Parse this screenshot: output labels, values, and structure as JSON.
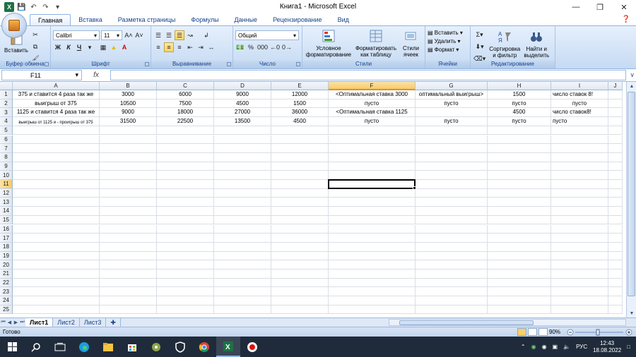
{
  "window": {
    "title": "Книга1 - Microsoft Excel"
  },
  "tabs": [
    "Главная",
    "Вставка",
    "Разметка страницы",
    "Формулы",
    "Данные",
    "Рецензирование",
    "Вид"
  ],
  "ribbon": {
    "clipboard": {
      "paste": "Вставить",
      "label": "Буфер обмена"
    },
    "font": {
      "name": "Calibri",
      "size": "11",
      "label": "Шрифт",
      "bold": "Ж",
      "italic": "К",
      "underline": "Ч"
    },
    "alignment": {
      "label": "Выравнивание"
    },
    "number": {
      "format": "Общий",
      "label": "Число",
      "percent": "%",
      "thousands": "000"
    },
    "styles": {
      "conditional": "Условное форматирование",
      "as_table": "Форматировать как таблицу",
      "cell_styles": "Стили ячеек",
      "label": "Стили"
    },
    "cells": {
      "insert": "Вставить",
      "delete": "Удалить",
      "format": "Формат",
      "label": "Ячейки"
    },
    "editing": {
      "sort": "Сортировка и фильтр",
      "find": "Найти и выделить",
      "label": "Редактирование"
    }
  },
  "formula_bar": {
    "name_box": "F11",
    "fx": "fx",
    "value": ""
  },
  "columns": [
    "A",
    "B",
    "C",
    "D",
    "E",
    "F",
    "G",
    "H",
    "I",
    "J"
  ],
  "rows": [
    "1",
    "2",
    "3",
    "4",
    "5",
    "6",
    "7",
    "8",
    "9",
    "10",
    "11",
    "12",
    "13",
    "14",
    "15",
    "16",
    "17",
    "18",
    "19",
    "20",
    "21",
    "22",
    "23",
    "24",
    "25"
  ],
  "cells": {
    "r1": [
      "375 и ставится 4 раза так же",
      "3000",
      "6000",
      "9000",
      "12000",
      "<Оптимальная ставка 3000",
      "оптимальный выигрыш>",
      "1500",
      "число ставок 8!"
    ],
    "r2": [
      "выигрыш от 375",
      "10500",
      "7500",
      "4500",
      "1500",
      "пусто",
      "пусто",
      "пусто",
      "пусто"
    ],
    "r3": [
      "1125 и ставится 4 раза так же",
      "9000",
      "18000",
      "27000",
      "36000",
      "<Оптимальная ставка 1125",
      "",
      "4500",
      "число ставок8!"
    ],
    "r4": [
      "выигрыш от 1125 и - проигрыш от 375",
      "31500",
      "22500",
      "13500",
      "4500",
      "пусто",
      "пусто",
      "пусто",
      "пусто"
    ]
  },
  "sheets": [
    "Лист1",
    "Лист2",
    "Лист3"
  ],
  "status": {
    "ready": "Готово",
    "zoom": "90%"
  },
  "taskbar": {
    "time": "12:43",
    "date": "18.08.2022",
    "lang": "РУС"
  }
}
